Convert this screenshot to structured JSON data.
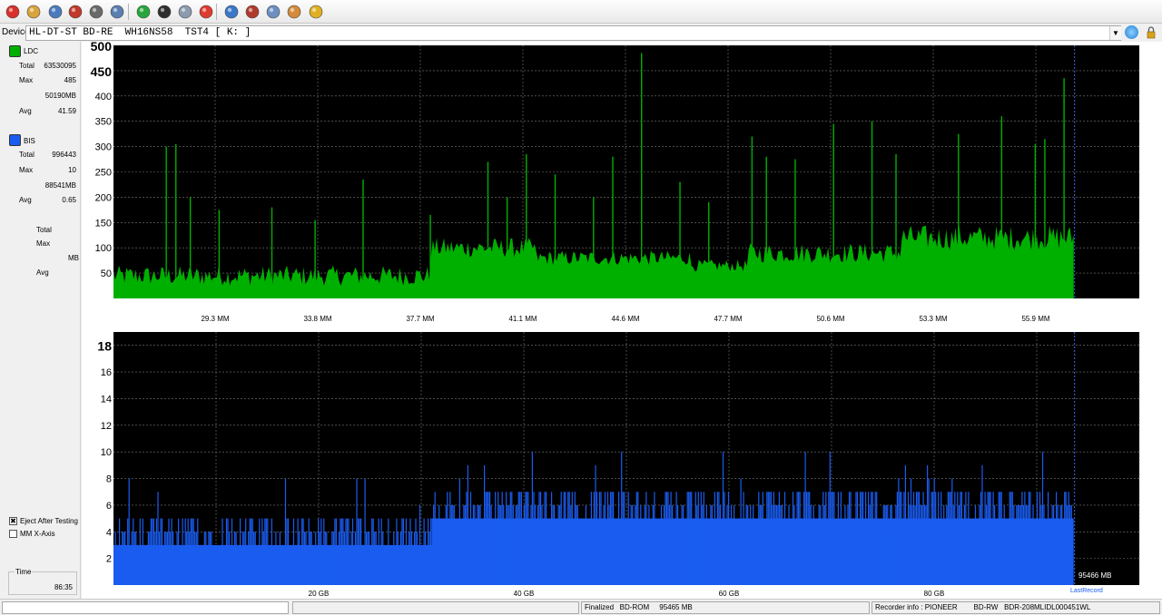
{
  "toolbar": {
    "buttons": [
      {
        "name": "power-icon",
        "color": "#d9302c"
      },
      {
        "name": "wand-icon",
        "color": "#d9a43a"
      },
      {
        "name": "drive-info-icon",
        "color": "#4a7bbd"
      },
      {
        "name": "erase-disc-icon",
        "color": "#c0392b"
      },
      {
        "name": "disc-tray-icon",
        "color": "#6a6a6a"
      },
      {
        "name": "copy-icon",
        "color": "#5a7fb0"
      },
      {
        "name": "refresh-green-icon",
        "color": "#27a63b"
      },
      {
        "name": "scan-disc-icon",
        "color": "#2e2e2e"
      },
      {
        "name": "settings-wheel-icon",
        "color": "#8c9bb0"
      },
      {
        "name": "stop-icon",
        "color": "#de3b2f"
      },
      {
        "name": "burn-icon",
        "color": "#3a78c8"
      },
      {
        "name": "hat-icon",
        "color": "#b03a2e"
      },
      {
        "name": "globe-icon",
        "color": "#6b8fc0"
      },
      {
        "name": "face-icon",
        "color": "#d48a3a"
      },
      {
        "name": "info-bars-icon",
        "color": "#e0b020"
      }
    ]
  },
  "device": {
    "label": "Device:",
    "value": "HL-DT-ST BD-RE  WH16NS58  TST4 [ K: ]"
  },
  "left": {
    "ldc": {
      "name": "LDC",
      "color": "#00b000",
      "total_label": "Total",
      "total": "63530095",
      "max_label": "Max",
      "max": "485",
      "mb": "50190MB",
      "avg_label": "Avg",
      "avg": "41.59"
    },
    "bis": {
      "name": "BIS",
      "color": "#1a5cf0",
      "total_label": "Total",
      "total": "996443",
      "max_label": "Max",
      "max": "10",
      "mb": "88541MB",
      "avg_label": "Avg",
      "avg": "0.65"
    },
    "third": {
      "total_label": "Total",
      "max_label": "Max",
      "mb_label": "MB",
      "avg_label": "Avg"
    },
    "eject_after_testing": {
      "label": "Eject After Testing",
      "checked": true
    },
    "mm_x_axis": {
      "label": "MM X-Axis",
      "checked": false
    },
    "time": {
      "label": "Time",
      "value": "86:35"
    }
  },
  "chart_data": [
    {
      "type": "area",
      "series": [
        {
          "name": "LDC",
          "color": "#00b000"
        }
      ],
      "y_ticks": [
        50,
        100,
        150,
        200,
        250,
        300,
        350,
        400,
        450,
        500
      ],
      "ylim": [
        0,
        500
      ],
      "x_tick_labels": [
        "29.3 MM",
        "33.8 MM",
        "37.7 MM",
        "41.1 MM",
        "44.6 MM",
        "47.7 MM",
        "50.6 MM",
        "53.3 MM",
        "55.9 MM"
      ],
      "segments": [
        {
          "from": 0.0,
          "to": 0.33,
          "base": 45,
          "noise": 20
        },
        {
          "from": 0.33,
          "to": 0.44,
          "base": 100,
          "noise": 20
        },
        {
          "from": 0.44,
          "to": 0.6,
          "base": 80,
          "noise": 15
        },
        {
          "from": 0.6,
          "to": 0.66,
          "base": 65,
          "noise": 12
        },
        {
          "from": 0.66,
          "to": 0.82,
          "base": 90,
          "noise": 20
        },
        {
          "from": 0.82,
          "to": 1.0,
          "base": 120,
          "noise": 25
        }
      ],
      "spikes": [
        {
          "x": 0.055,
          "y": 300
        },
        {
          "x": 0.065,
          "y": 305
        },
        {
          "x": 0.08,
          "y": 200
        },
        {
          "x": 0.11,
          "y": 175
        },
        {
          "x": 0.165,
          "y": 180
        },
        {
          "x": 0.21,
          "y": 155
        },
        {
          "x": 0.26,
          "y": 235
        },
        {
          "x": 0.33,
          "y": 165
        },
        {
          "x": 0.39,
          "y": 270
        },
        {
          "x": 0.41,
          "y": 200
        },
        {
          "x": 0.43,
          "y": 285
        },
        {
          "x": 0.46,
          "y": 245
        },
        {
          "x": 0.5,
          "y": 200
        },
        {
          "x": 0.52,
          "y": 280
        },
        {
          "x": 0.55,
          "y": 485
        },
        {
          "x": 0.59,
          "y": 230
        },
        {
          "x": 0.62,
          "y": 190
        },
        {
          "x": 0.665,
          "y": 320
        },
        {
          "x": 0.68,
          "y": 280
        },
        {
          "x": 0.71,
          "y": 275
        },
        {
          "x": 0.75,
          "y": 345
        },
        {
          "x": 0.79,
          "y": 350
        },
        {
          "x": 0.815,
          "y": 285
        },
        {
          "x": 0.88,
          "y": 325
        },
        {
          "x": 0.925,
          "y": 360
        },
        {
          "x": 0.96,
          "y": 305
        },
        {
          "x": 0.97,
          "y": 315
        },
        {
          "x": 0.99,
          "y": 435
        }
      ],
      "data_end": 0.936
    },
    {
      "type": "bar",
      "series": [
        {
          "name": "BIS",
          "color": "#1a5cf0"
        }
      ],
      "y_ticks": [
        2,
        4,
        6,
        8,
        10,
        12,
        14,
        16,
        18
      ],
      "ylim": [
        0,
        19
      ],
      "xlim": [
        0,
        100
      ],
      "x_ticks": [
        20,
        40,
        60,
        80
      ],
      "x_tick_labels": [
        "20 GB",
        "40 GB",
        "60 GB",
        "80 GB"
      ],
      "segments": [
        {
          "from": 0,
          "to": 31,
          "level": 3
        },
        {
          "from": 31,
          "to": 93.5,
          "level": 5
        }
      ],
      "data_end": 93.5,
      "end_label": "95466 MB",
      "last_record_label": "LastRecord"
    }
  ],
  "status": {
    "finalized": "Finalized   BD-ROM     95465 MB",
    "recorder": "Recorder info : PIONEER        BD-RW   BDR-208MLIDL000451WL"
  }
}
